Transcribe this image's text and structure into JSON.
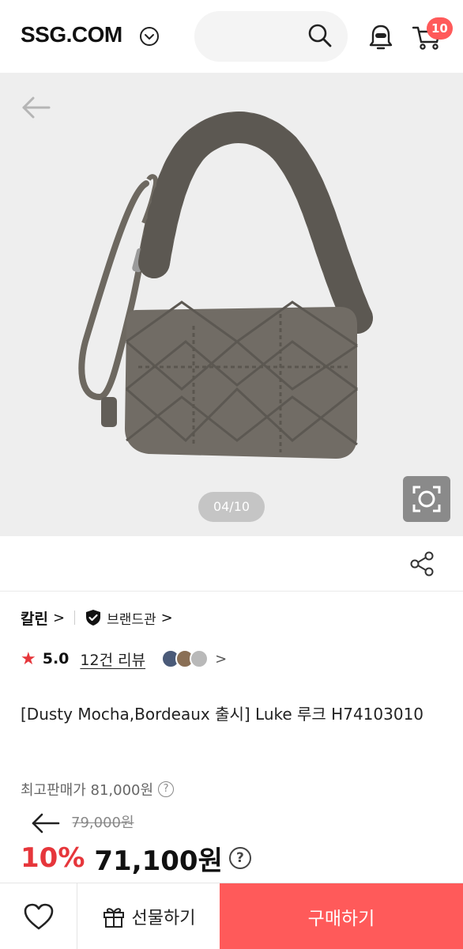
{
  "header": {
    "logo": "SSG.COM",
    "cart_count": "10"
  },
  "gallery": {
    "page_indicator": "04/10"
  },
  "brand": {
    "name": "칼린",
    "name_chevron": ">",
    "store_link": "브랜드관",
    "store_chevron": ">"
  },
  "rating": {
    "star": "★",
    "score": "5.0",
    "review_link": "12건 리뷰",
    "more_chevron": ">"
  },
  "product": {
    "title": "[Dusty Mocha,Bordeaux 출시] Luke 루크 H74103010"
  },
  "price": {
    "top_price": "최고판매가 81,000원",
    "original": "79,000원",
    "discount": "10%",
    "sale": "71,100원",
    "help_glyph": "?"
  },
  "bottom_bar": {
    "gift_label": "선물하기",
    "buy_label": "구매하기"
  },
  "colors": {
    "accent": "#ff5a5a",
    "sale_red": "#e6363b"
  }
}
